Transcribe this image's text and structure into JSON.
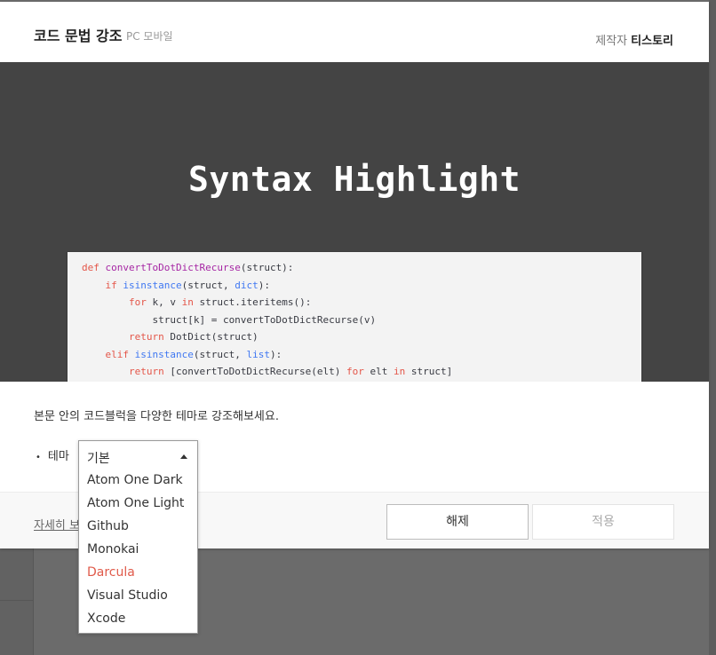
{
  "modal": {
    "title": "코드 문법 강조",
    "platform": "PC 모바일",
    "maker_label": "제작자",
    "maker_name": "티스토리"
  },
  "preview": {
    "title": "Syntax Highlight",
    "code_lines": [
      [
        {
          "t": "def ",
          "c": "kw"
        },
        {
          "t": "convertToDotDictRecurse",
          "c": "fn"
        },
        {
          "t": "(struct):",
          "c": ""
        }
      ],
      [
        {
          "t": "    ",
          "c": ""
        },
        {
          "t": "if ",
          "c": "kw"
        },
        {
          "t": "isinstance",
          "c": "bi"
        },
        {
          "t": "(struct, ",
          "c": ""
        },
        {
          "t": "dict",
          "c": "bi"
        },
        {
          "t": "):",
          "c": ""
        }
      ],
      [
        {
          "t": "        ",
          "c": ""
        },
        {
          "t": "for ",
          "c": "kw"
        },
        {
          "t": "k, v ",
          "c": ""
        },
        {
          "t": "in ",
          "c": "kw"
        },
        {
          "t": "struct.iteritems():",
          "c": ""
        }
      ],
      [
        {
          "t": "            struct[k] = convertToDotDictRecurse(v)",
          "c": ""
        }
      ],
      [
        {
          "t": "        ",
          "c": ""
        },
        {
          "t": "return ",
          "c": "kw"
        },
        {
          "t": "DotDict(struct)",
          "c": ""
        }
      ],
      [
        {
          "t": "    ",
          "c": ""
        },
        {
          "t": "elif ",
          "c": "kw"
        },
        {
          "t": "isinstance",
          "c": "bi"
        },
        {
          "t": "(struct, ",
          "c": ""
        },
        {
          "t": "list",
          "c": "bi"
        },
        {
          "t": "):",
          "c": ""
        }
      ],
      [
        {
          "t": "        ",
          "c": ""
        },
        {
          "t": "return ",
          "c": "kw"
        },
        {
          "t": "[convertToDotDictRecurse(elt) ",
          "c": ""
        },
        {
          "t": "for ",
          "c": "kw"
        },
        {
          "t": "elt ",
          "c": ""
        },
        {
          "t": "in ",
          "c": "kw"
        },
        {
          "t": "struct]",
          "c": ""
        }
      ]
    ]
  },
  "body": {
    "description": "본문 안의 코드블럭을 다양한 테마로 강조해보세요.",
    "theme_bullet": "•",
    "theme_label": "테마"
  },
  "dropdown": {
    "selected": "기본",
    "options": [
      "Atom One Dark",
      "Atom One Light",
      "Github",
      "Monokai",
      "Darcula",
      "Visual Studio",
      "Xcode"
    ],
    "highlighted_option": "Darcula"
  },
  "footer": {
    "detail_link": "자세히 보기",
    "release_label": "해제",
    "apply_label": "적용"
  },
  "colors": {
    "accent": "#e05a4a",
    "keyword": "#e45649",
    "function": "#a626a4",
    "builtin": "#4078f2"
  }
}
